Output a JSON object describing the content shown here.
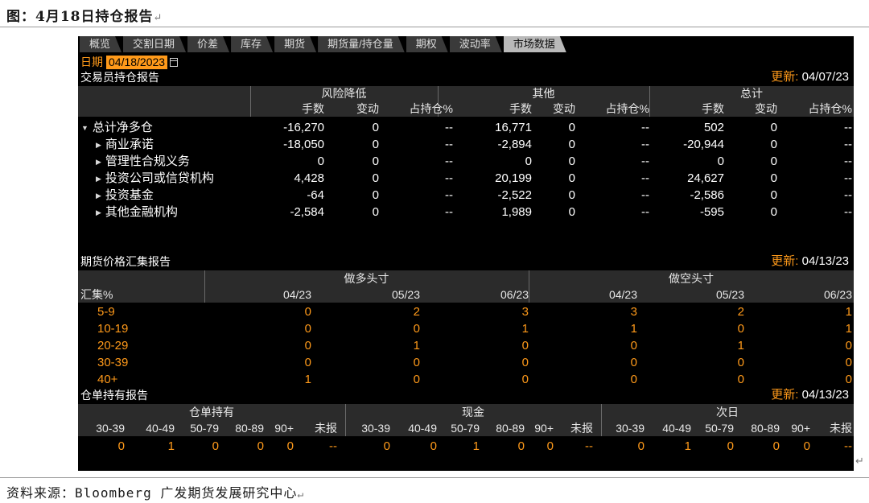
{
  "figure": {
    "title": "图：4月18日持仓报告",
    "source": "资料来源：Bloomberg  广发期货发展研究中心"
  },
  "tabs": [
    "概览",
    "交割日期",
    "价差",
    "库存",
    "期货",
    "期货量/持仓量",
    "期权",
    "波动率",
    "市场数据"
  ],
  "active_tab": 8,
  "date": {
    "label": "日期",
    "value": "04/18/2023"
  },
  "trader_report": {
    "title": "交易员持仓报告",
    "update_label": "更新:",
    "update_date": "04/07/23",
    "groups": [
      "风险降低",
      "其他",
      "总计"
    ],
    "subheaders": [
      "手数",
      "变动",
      "占持仓%"
    ],
    "rows": [
      {
        "label": "总计净多仓",
        "expanded": true,
        "values": [
          "-16,270",
          "0",
          "--",
          "16,771",
          "0",
          "--",
          "502",
          "0",
          "--"
        ]
      },
      {
        "label": "商业承诺",
        "values": [
          "-18,050",
          "0",
          "--",
          "-2,894",
          "0",
          "--",
          "-20,944",
          "0",
          "--"
        ]
      },
      {
        "label": "管理性合规义务",
        "values": [
          "0",
          "0",
          "--",
          "0",
          "0",
          "--",
          "0",
          "0",
          "--"
        ]
      },
      {
        "label": "投资公司或信贷机构",
        "values": [
          "4,428",
          "0",
          "--",
          "20,199",
          "0",
          "--",
          "24,627",
          "0",
          "--"
        ]
      },
      {
        "label": "投资基金",
        "values": [
          "-64",
          "0",
          "--",
          "-2,522",
          "0",
          "--",
          "-2,586",
          "0",
          "--"
        ]
      },
      {
        "label": "其他金融机构",
        "values": [
          "-2,584",
          "0",
          "--",
          "1,989",
          "0",
          "--",
          "-595",
          "0",
          "--"
        ]
      }
    ]
  },
  "futures_report": {
    "title": "期货价格汇集报告",
    "update_label": "更新:",
    "update_date": "04/13/23",
    "groups": [
      "做多头寸",
      "做空头寸"
    ],
    "row_header": "汇集%",
    "months": [
      "04/23",
      "05/23",
      "06/23",
      "04/23",
      "05/23",
      "06/23"
    ],
    "rows": [
      {
        "label": "5-9",
        "values": [
          "0",
          "2",
          "3",
          "3",
          "2",
          "1"
        ]
      },
      {
        "label": "10-19",
        "values": [
          "0",
          "0",
          "1",
          "1",
          "0",
          "1"
        ]
      },
      {
        "label": "20-29",
        "values": [
          "0",
          "1",
          "0",
          "0",
          "1",
          "0"
        ]
      },
      {
        "label": "30-39",
        "values": [
          "0",
          "0",
          "0",
          "0",
          "0",
          "0"
        ]
      },
      {
        "label": "40+",
        "values": [
          "1",
          "0",
          "0",
          "0",
          "0",
          "0"
        ]
      }
    ]
  },
  "warrant_report": {
    "title": "仓单持有报告",
    "update_label": "更新:",
    "update_date": "04/13/23",
    "groups": [
      "仓单持有",
      "现金",
      "次日"
    ],
    "subheaders": [
      "30-39",
      "40-49",
      "50-79",
      "80-89",
      "90+",
      "未报"
    ],
    "values": [
      "0",
      "1",
      "0",
      "0",
      "0",
      "--",
      "0",
      "0",
      "1",
      "0",
      "0",
      "--",
      "0",
      "1",
      "0",
      "0",
      "0",
      "--"
    ]
  },
  "colors": {
    "accent": "#ff9a1a",
    "background": "#000000",
    "header": "#2b2b2b"
  }
}
